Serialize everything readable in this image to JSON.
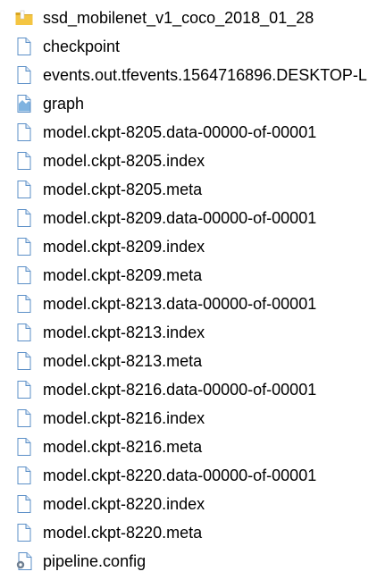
{
  "files": [
    {
      "name": "ssd_mobilenet_v1_coco_2018_01_28",
      "icon": "folder-icon",
      "kind": "folder"
    },
    {
      "name": "checkpoint",
      "icon": "document-icon",
      "kind": "file"
    },
    {
      "name": "events.out.tfevents.1564716896.DESKTOP-L",
      "icon": "document-icon",
      "kind": "file"
    },
    {
      "name": "graph",
      "icon": "image-file-icon",
      "kind": "image"
    },
    {
      "name": "model.ckpt-8205.data-00000-of-00001",
      "icon": "document-icon",
      "kind": "file"
    },
    {
      "name": "model.ckpt-8205.index",
      "icon": "document-icon",
      "kind": "file"
    },
    {
      "name": "model.ckpt-8205.meta",
      "icon": "document-icon",
      "kind": "file"
    },
    {
      "name": "model.ckpt-8209.data-00000-of-00001",
      "icon": "document-icon",
      "kind": "file"
    },
    {
      "name": "model.ckpt-8209.index",
      "icon": "document-icon",
      "kind": "file"
    },
    {
      "name": "model.ckpt-8209.meta",
      "icon": "document-icon",
      "kind": "file"
    },
    {
      "name": "model.ckpt-8213.data-00000-of-00001",
      "icon": "document-icon",
      "kind": "file"
    },
    {
      "name": "model.ckpt-8213.index",
      "icon": "document-icon",
      "kind": "file"
    },
    {
      "name": "model.ckpt-8213.meta",
      "icon": "document-icon",
      "kind": "file"
    },
    {
      "name": "model.ckpt-8216.data-00000-of-00001",
      "icon": "document-icon",
      "kind": "file"
    },
    {
      "name": "model.ckpt-8216.index",
      "icon": "document-icon",
      "kind": "file"
    },
    {
      "name": "model.ckpt-8216.meta",
      "icon": "document-icon",
      "kind": "file"
    },
    {
      "name": "model.ckpt-8220.data-00000-of-00001",
      "icon": "document-icon",
      "kind": "file"
    },
    {
      "name": "model.ckpt-8220.index",
      "icon": "document-icon",
      "kind": "file"
    },
    {
      "name": "model.ckpt-8220.meta",
      "icon": "document-icon",
      "kind": "file"
    },
    {
      "name": "pipeline.config",
      "icon": "settings-file-icon",
      "kind": "config"
    }
  ],
  "colors": {
    "folder": "#f4c542",
    "folder_shadow": "#d9a520",
    "doc_border": "#5b8fc7",
    "doc_fill": "#ffffff",
    "doc_fold": "#dce8f5",
    "image_fill": "#7fb3e0",
    "text": "#000000"
  }
}
